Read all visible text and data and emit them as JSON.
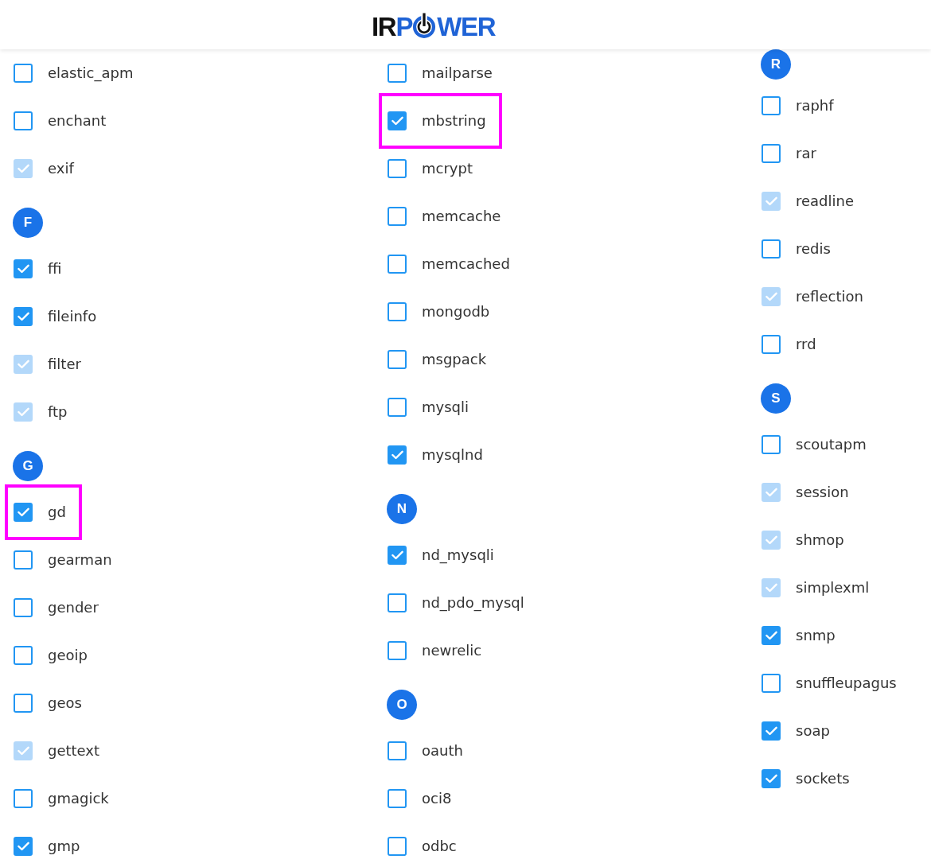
{
  "logo": {
    "before_icon": [
      {
        "text": "IR",
        "color": "#111111"
      },
      {
        "text": "P",
        "color": "#1f63d6"
      }
    ],
    "after_icon": [
      {
        "text": "WER",
        "color": "#1f63d6"
      }
    ]
  },
  "columns": [
    {
      "entries": [
        {
          "kind": "option",
          "label": "elastic_apm",
          "checked": false,
          "disabled": false,
          "highlighted": false
        },
        {
          "kind": "option",
          "label": "enchant",
          "checked": false,
          "disabled": false,
          "highlighted": false
        },
        {
          "kind": "option",
          "label": "exif",
          "checked": true,
          "disabled": true,
          "highlighted": false
        },
        {
          "kind": "letter",
          "text": "F"
        },
        {
          "kind": "option",
          "label": "ffi",
          "checked": true,
          "disabled": false,
          "highlighted": false
        },
        {
          "kind": "option",
          "label": "fileinfo",
          "checked": true,
          "disabled": false,
          "highlighted": false
        },
        {
          "kind": "option",
          "label": "filter",
          "checked": true,
          "disabled": true,
          "highlighted": false
        },
        {
          "kind": "option",
          "label": "ftp",
          "checked": true,
          "disabled": true,
          "highlighted": false
        },
        {
          "kind": "letter",
          "text": "G"
        },
        {
          "kind": "option",
          "label": "gd",
          "checked": true,
          "disabled": false,
          "highlighted": true
        },
        {
          "kind": "option",
          "label": "gearman",
          "checked": false,
          "disabled": false,
          "highlighted": false
        },
        {
          "kind": "option",
          "label": "gender",
          "checked": false,
          "disabled": false,
          "highlighted": false
        },
        {
          "kind": "option",
          "label": "geoip",
          "checked": false,
          "disabled": false,
          "highlighted": false
        },
        {
          "kind": "option",
          "label": "geos",
          "checked": false,
          "disabled": false,
          "highlighted": false
        },
        {
          "kind": "option",
          "label": "gettext",
          "checked": true,
          "disabled": true,
          "highlighted": false
        },
        {
          "kind": "option",
          "label": "gmagick",
          "checked": false,
          "disabled": false,
          "highlighted": false
        },
        {
          "kind": "option",
          "label": "gmp",
          "checked": true,
          "disabled": false,
          "highlighted": false
        }
      ]
    },
    {
      "entries": [
        {
          "kind": "option",
          "label": "mailparse",
          "checked": false,
          "disabled": false,
          "highlighted": false
        },
        {
          "kind": "option",
          "label": "mbstring",
          "checked": true,
          "disabled": false,
          "highlighted": true
        },
        {
          "kind": "option",
          "label": "mcrypt",
          "checked": false,
          "disabled": false,
          "highlighted": false
        },
        {
          "kind": "option",
          "label": "memcache",
          "checked": false,
          "disabled": false,
          "highlighted": false
        },
        {
          "kind": "option",
          "label": "memcached",
          "checked": false,
          "disabled": false,
          "highlighted": false
        },
        {
          "kind": "option",
          "label": "mongodb",
          "checked": false,
          "disabled": false,
          "highlighted": false
        },
        {
          "kind": "option",
          "label": "msgpack",
          "checked": false,
          "disabled": false,
          "highlighted": false
        },
        {
          "kind": "option",
          "label": "mysqli",
          "checked": false,
          "disabled": false,
          "highlighted": false
        },
        {
          "kind": "option",
          "label": "mysqlnd",
          "checked": true,
          "disabled": false,
          "highlighted": false
        },
        {
          "kind": "letter",
          "text": "N"
        },
        {
          "kind": "option",
          "label": "nd_mysqli",
          "checked": true,
          "disabled": false,
          "highlighted": false
        },
        {
          "kind": "option",
          "label": "nd_pdo_mysql",
          "checked": false,
          "disabled": false,
          "highlighted": false
        },
        {
          "kind": "option",
          "label": "newrelic",
          "checked": false,
          "disabled": false,
          "highlighted": false
        },
        {
          "kind": "letter",
          "text": "O"
        },
        {
          "kind": "option",
          "label": "oauth",
          "checked": false,
          "disabled": false,
          "highlighted": false
        },
        {
          "kind": "option",
          "label": "oci8",
          "checked": false,
          "disabled": false,
          "highlighted": false
        },
        {
          "kind": "option",
          "label": "odbc",
          "checked": false,
          "disabled": false,
          "highlighted": false
        }
      ]
    },
    {
      "entries": [
        {
          "kind": "letter",
          "text": "R"
        },
        {
          "kind": "option",
          "label": "raphf",
          "checked": false,
          "disabled": false,
          "highlighted": false
        },
        {
          "kind": "option",
          "label": "rar",
          "checked": false,
          "disabled": false,
          "highlighted": false
        },
        {
          "kind": "option",
          "label": "readline",
          "checked": true,
          "disabled": true,
          "highlighted": false
        },
        {
          "kind": "option",
          "label": "redis",
          "checked": false,
          "disabled": false,
          "highlighted": false
        },
        {
          "kind": "option",
          "label": "reflection",
          "checked": true,
          "disabled": true,
          "highlighted": false
        },
        {
          "kind": "option",
          "label": "rrd",
          "checked": false,
          "disabled": false,
          "highlighted": false
        },
        {
          "kind": "letter",
          "text": "S"
        },
        {
          "kind": "option",
          "label": "scoutapm",
          "checked": false,
          "disabled": false,
          "highlighted": false
        },
        {
          "kind": "option",
          "label": "session",
          "checked": true,
          "disabled": true,
          "highlighted": false
        },
        {
          "kind": "option",
          "label": "shmop",
          "checked": true,
          "disabled": true,
          "highlighted": false
        },
        {
          "kind": "option",
          "label": "simplexml",
          "checked": true,
          "disabled": true,
          "highlighted": false
        },
        {
          "kind": "option",
          "label": "snmp",
          "checked": true,
          "disabled": false,
          "highlighted": false
        },
        {
          "kind": "option",
          "label": "snuffleupagus",
          "checked": false,
          "disabled": false,
          "highlighted": false
        },
        {
          "kind": "option",
          "label": "soap",
          "checked": true,
          "disabled": false,
          "highlighted": false
        },
        {
          "kind": "option",
          "label": "sockets",
          "checked": true,
          "disabled": false,
          "highlighted": false
        }
      ]
    }
  ]
}
